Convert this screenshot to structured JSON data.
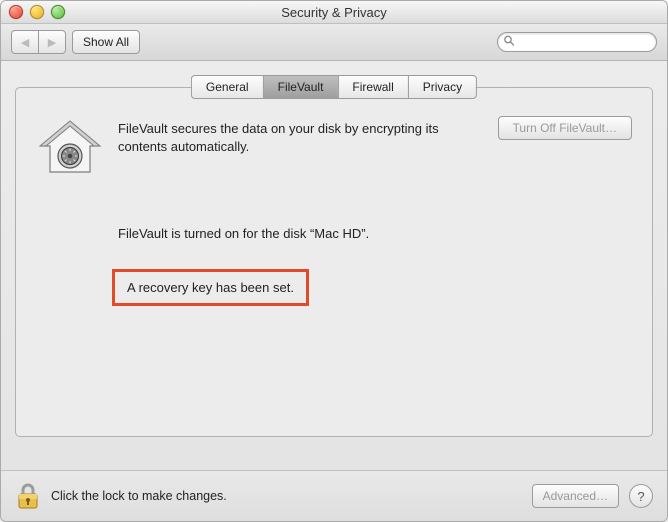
{
  "window": {
    "title": "Security & Privacy"
  },
  "toolbar": {
    "show_all": "Show All",
    "search_placeholder": ""
  },
  "tabs": {
    "general": "General",
    "filevault": "FileVault",
    "firewall": "Firewall",
    "privacy": "Privacy",
    "active": "filevault"
  },
  "pane": {
    "description": "FileVault secures the data on your disk by encrypting its contents automatically.",
    "turn_off_label": "Turn Off FileVault…",
    "status": "FileVault is turned on for the disk “Mac HD”.",
    "recovery": "A recovery key has been set."
  },
  "footer": {
    "lock_text": "Click the lock to make changes.",
    "advanced_label": "Advanced…"
  }
}
